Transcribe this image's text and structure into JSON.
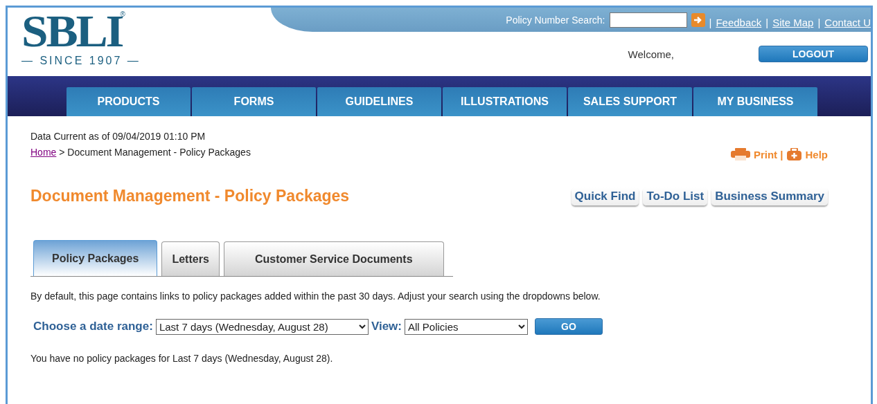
{
  "logo": {
    "wordmark": "SBLI",
    "registered": "®",
    "tagline": "— SINCE 1907 —"
  },
  "top_bar": {
    "search_label": "Policy Number Search:",
    "items": [
      {
        "kind": "separator",
        "text": "|"
      },
      {
        "kind": "link",
        "text": "Feedback"
      },
      {
        "kind": "separator",
        "text": "|"
      },
      {
        "kind": "link",
        "text": "Site Map"
      },
      {
        "kind": "separator",
        "text": "|"
      },
      {
        "kind": "link",
        "text": "Contact U"
      }
    ]
  },
  "welcome": "Welcome,",
  "logout": "LOGOUT",
  "nav": [
    "PRODUCTS",
    "FORMS",
    "GUIDELINES",
    "ILLUSTRATIONS",
    "SALES SUPPORT",
    "MY BUSINESS"
  ],
  "data_current": "Data Current as of 09/04/2019 01:10 PM",
  "breadcrumb": {
    "home": "Home",
    "rest": "> Document Management - Policy Packages"
  },
  "utility_links": [
    {
      "kind": "print",
      "label": "Print |"
    },
    {
      "kind": "help",
      "label": "Help"
    }
  ],
  "page_title": "Document Management - Policy Packages",
  "quick_buttons": [
    "Quick Find",
    "To-Do List",
    "Business Summary"
  ],
  "tabs": [
    {
      "label": "Policy Packages",
      "selected": true
    },
    {
      "label": "Letters",
      "selected": false
    },
    {
      "label": "Customer Service Documents",
      "selected": false
    }
  ],
  "intro": "By default, this page contains links to policy packages added within the past 30 days. Adjust your search using the dropdowns below.",
  "filters": {
    "date_label": "Choose a date range:",
    "date_value": "Last 7 days (Wednesday, August 28)",
    "view_label": "View:",
    "view_value": "All Policies",
    "go": "GO"
  },
  "message": "You have no policy packages for Last 7 days (Wednesday, August 28)."
}
